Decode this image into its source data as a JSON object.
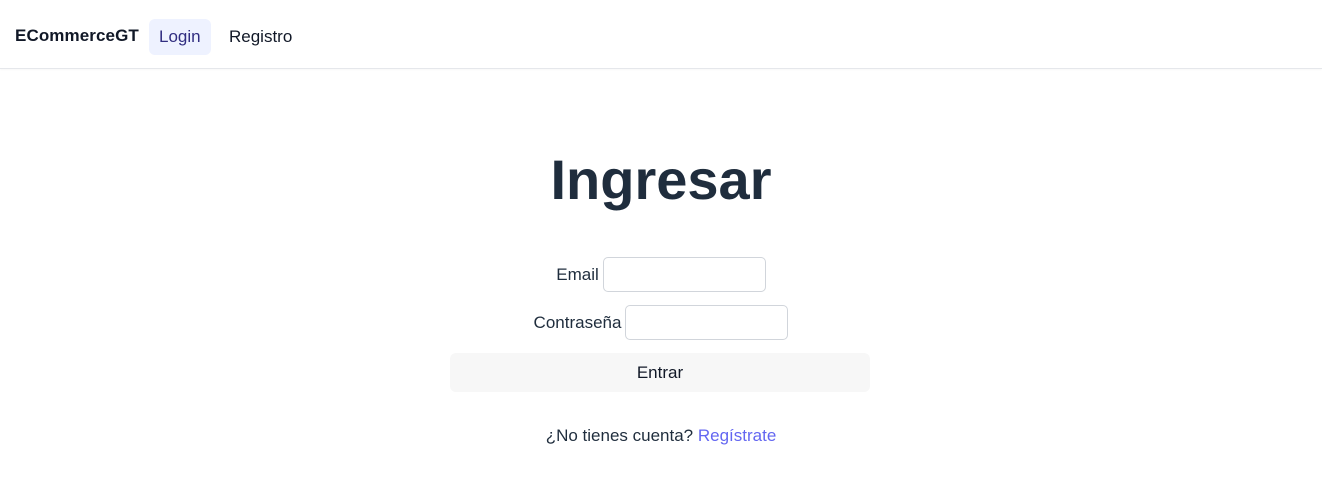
{
  "nav": {
    "brand": "ECommerceGT",
    "links": [
      {
        "label": "Login",
        "active": true
      },
      {
        "label": "Registro",
        "active": false
      }
    ]
  },
  "page": {
    "title": "Ingresar"
  },
  "form": {
    "email": {
      "label": "Email",
      "value": "",
      "placeholder": ""
    },
    "password": {
      "label": "Contraseña",
      "value": "",
      "placeholder": ""
    },
    "submit_label": "Entrar"
  },
  "footer": {
    "prompt": "¿No tienes cuenta?",
    "link_label": "Regístrate"
  },
  "colors": {
    "accent": "#6366f1",
    "active_nav_bg": "#eef2ff",
    "title": "#1f2d3d"
  }
}
